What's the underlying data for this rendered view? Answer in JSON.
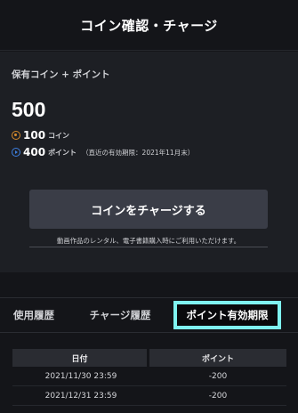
{
  "header": {
    "title": "コイン確認・チャージ"
  },
  "holdings": {
    "section_label": "保有コイン + ポイント",
    "total": "500",
    "coins": {
      "value": "100",
      "unit": "コイン",
      "icon": "coin-icon",
      "color": "#d98b2b"
    },
    "points": {
      "value": "400",
      "unit": "ポイント",
      "note": "（直近の有効期限：2021年11月末）",
      "icon": "point-icon",
      "color": "#3d7fe0"
    }
  },
  "charge": {
    "button_label": "コインをチャージする",
    "hint": "動画作品のレンタル、電子書籍購入時にご利用いただけます。"
  },
  "tabs": [
    {
      "label": "使用履歴",
      "active": false
    },
    {
      "label": "チャージ履歴",
      "active": false
    },
    {
      "label": "ポイント有効期限",
      "active": true
    }
  ],
  "history": {
    "columns": [
      "日付",
      "ポイント"
    ],
    "rows": [
      {
        "date": "2021/11/30 23:59",
        "points": "-200"
      },
      {
        "date": "2021/12/31 23:59",
        "points": "-200"
      }
    ]
  },
  "colors": {
    "highlight": "#7ff3f0",
    "background": "#141519",
    "panel": "#1d1f24"
  }
}
